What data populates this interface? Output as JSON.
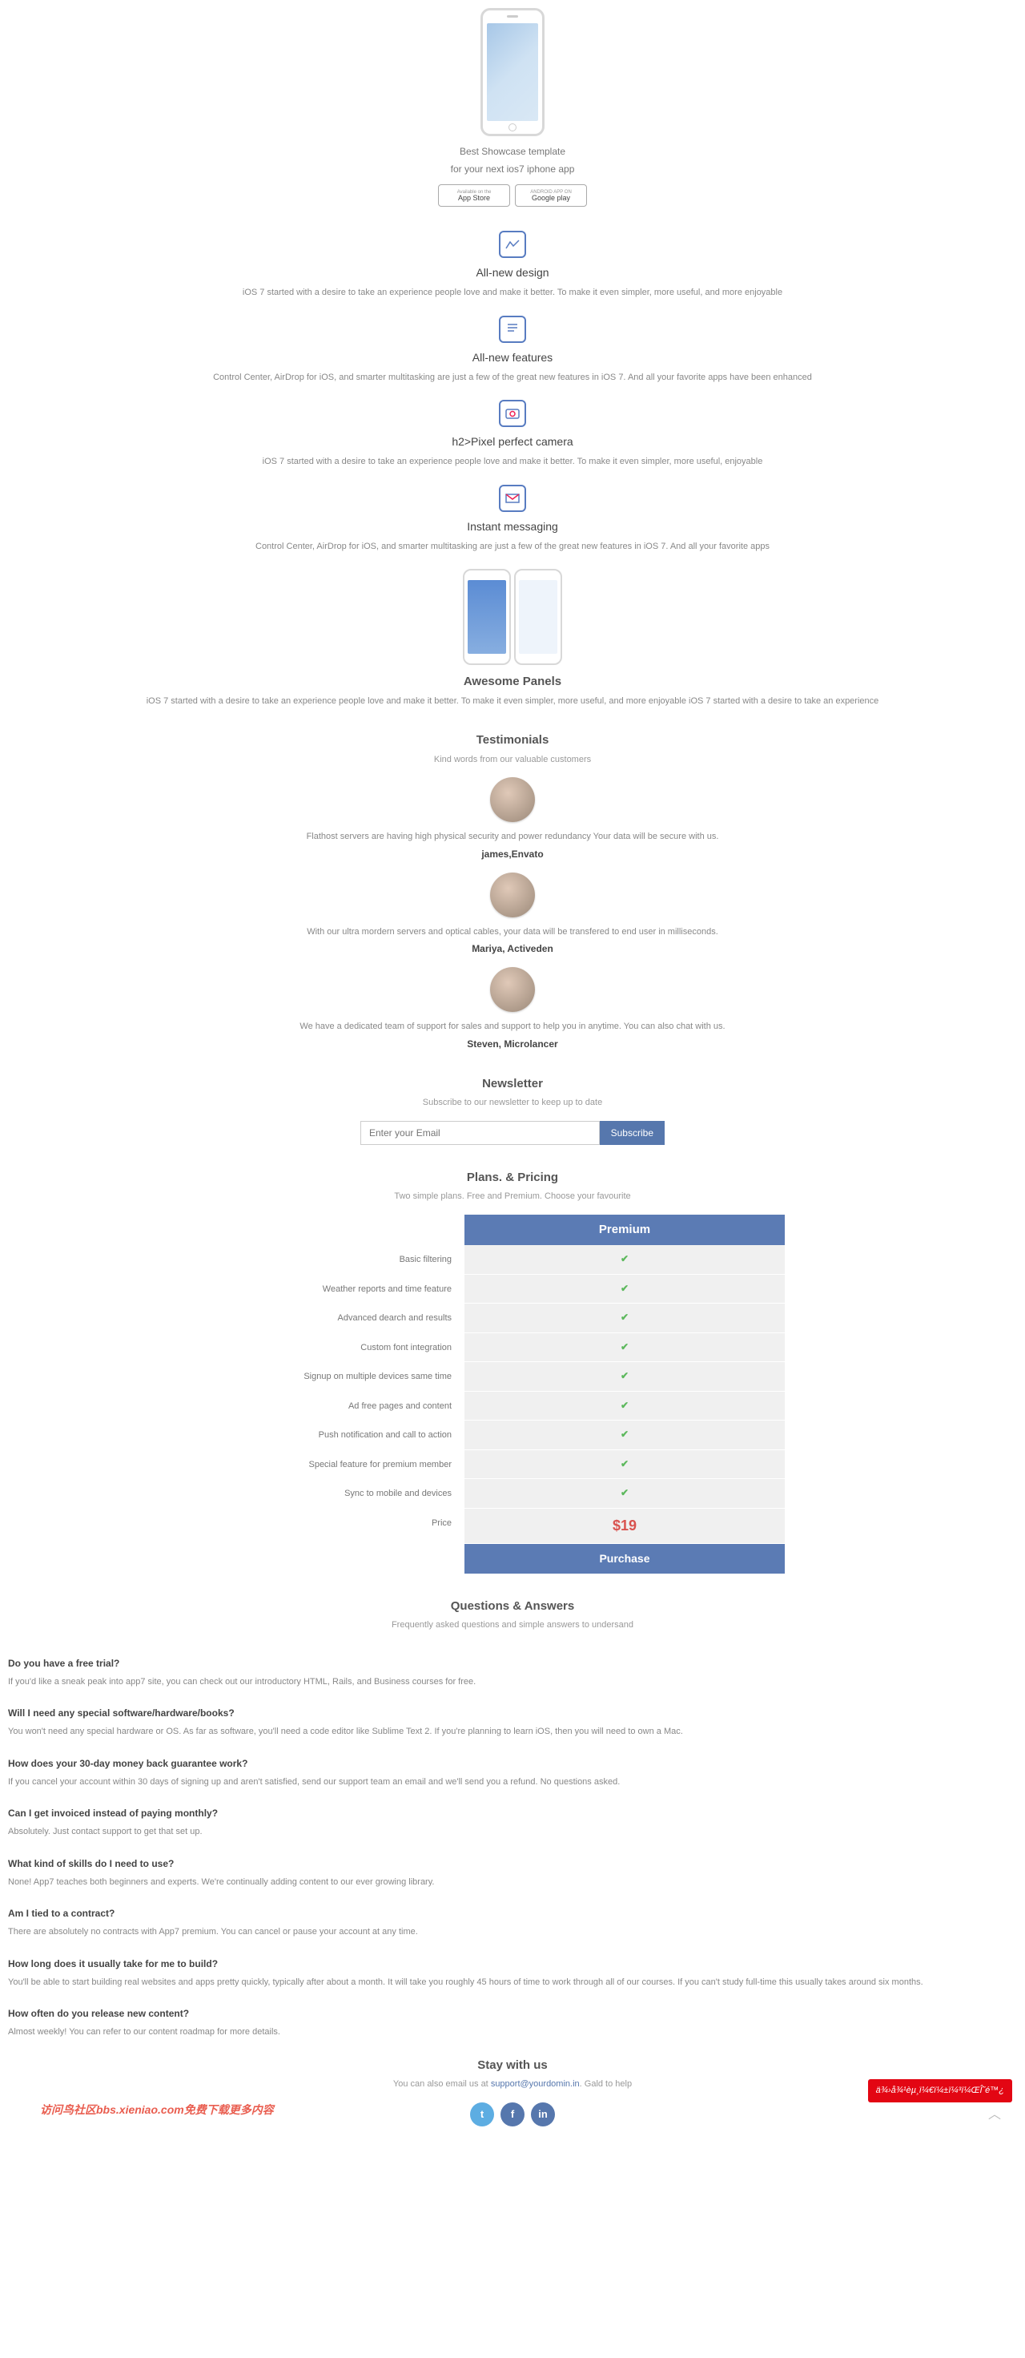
{
  "hero": {
    "line1": "Best Showcase template",
    "line2": "for your next ios7 iphone app",
    "appstore": "App Store",
    "appstore_hint": "Available on the",
    "gplay": "Google play",
    "gplay_hint": "ANDROID APP ON"
  },
  "features": [
    {
      "title": "All-new design",
      "desc": "iOS 7 started with a desire to take an experience people love and make it better. To make it even simpler, more useful, and more enjoyable"
    },
    {
      "title": "All-new features",
      "desc": "Control Center, AirDrop for iOS, and smarter multitasking are just a few of the great new features in iOS 7. And all your favorite apps have been enhanced"
    },
    {
      "title": "h2>Pixel perfect camera",
      "desc": "iOS 7 started with a desire to take an experience people love and make it better. To make it even simpler, more useful, enjoyable"
    },
    {
      "title": "Instant messaging",
      "desc": "Control Center, AirDrop for iOS, and smarter multitasking are just a few of the great new features in iOS 7. And all your favorite apps"
    }
  ],
  "panels": {
    "title": "Awesome Panels",
    "desc": "iOS 7 started with a desire to take an experience people love and make it better. To make it even simpler, more useful, and more enjoyable iOS 7 started with a desire to take an experience"
  },
  "testimonials": {
    "title": "Testimonials",
    "sub": "Kind words from our valuable customers",
    "items": [
      {
        "text": "Flathost servers are having high physical security and power redundancy Your data will be secure with us.",
        "name": "james,Envato"
      },
      {
        "text": "With our ultra mordern servers and optical cables, your data will be transfered to end user in milliseconds.",
        "name": "Mariya, Activeden"
      },
      {
        "text": "We have a dedicated team of support for sales and support to help you in anytime. You can also chat with us.",
        "name": "Steven, Microlancer"
      }
    ]
  },
  "newsletter": {
    "title": "Newsletter",
    "sub": "Subscribe to our newsletter to keep up to date",
    "placeholder": "Enter your Email",
    "button": "Subscribe"
  },
  "plans": {
    "title": "Plans. & Pricing",
    "sub": "Two simple plans. Free and Premium. Choose your favourite",
    "premium_head": "Premium",
    "features": [
      "Basic filtering",
      "Weather reports and time feature",
      "Advanced dearch and results",
      "Custom font integration",
      "Signup on multiple devices same time",
      "Ad free pages and content",
      "Push notification and call to action",
      "Special feature for premium member",
      "Sync to mobile and devices"
    ],
    "price_label": "Price",
    "price": "$19",
    "purchase": "Purchase"
  },
  "qa": {
    "title": "Questions & Answers",
    "sub": "Frequently asked questions and simple answers to undersand",
    "items": [
      {
        "q": "Do you have a free trial?",
        "a": "If you'd like a sneak peak into app7 site, you can check out our introductory HTML, Rails, and Business courses for free."
      },
      {
        "q": "Will I need any special software/hardware/books?",
        "a": "You won't need any special hardware or OS. As far as software, you'll need a code editor like Sublime Text 2. If you're planning to learn iOS, then you will need to own a Mac."
      },
      {
        "q": "How does your 30-day money back guarantee work?",
        "a": "If you cancel your account within 30 days of signing up and aren't satisfied, send our support team an email and we'll send you a refund. No questions asked."
      },
      {
        "q": "Can I get invoiced instead of paying monthly?",
        "a": "Absolutely. Just contact support to get that set up."
      },
      {
        "q": "What kind of skills do I need to use?",
        "a": "None! App7 teaches both beginners and experts. We're continually adding content to our ever growing library."
      },
      {
        "q": "Am I tied to a contract?",
        "a": "There are absolutely no contracts with App7 premium. You can cancel or pause your account at any time."
      },
      {
        "q": "How long does it usually take for me to build?",
        "a": "You'll be able to start building real websites and apps pretty quickly, typically after about a month. It will take you roughly 45 hours of time to work through all of our courses. If you can't study full-time this usually takes around six months."
      },
      {
        "q": "How often do you release new content?",
        "a": "Almost weekly! You can refer to our content roadmap for more details."
      }
    ]
  },
  "stay": {
    "title": "Stay with us",
    "pre": "You can also email us at ",
    "email": "support@yourdomin.in",
    "post": ". Gald to help"
  },
  "watermark": "访问鸟社区bbs.xieniao.com免费下载更多内容",
  "badge": "ä¾›å¾¹èµ¸ï¼€ï¼±ï¼³ï¼ŒÎ˜é™¿"
}
